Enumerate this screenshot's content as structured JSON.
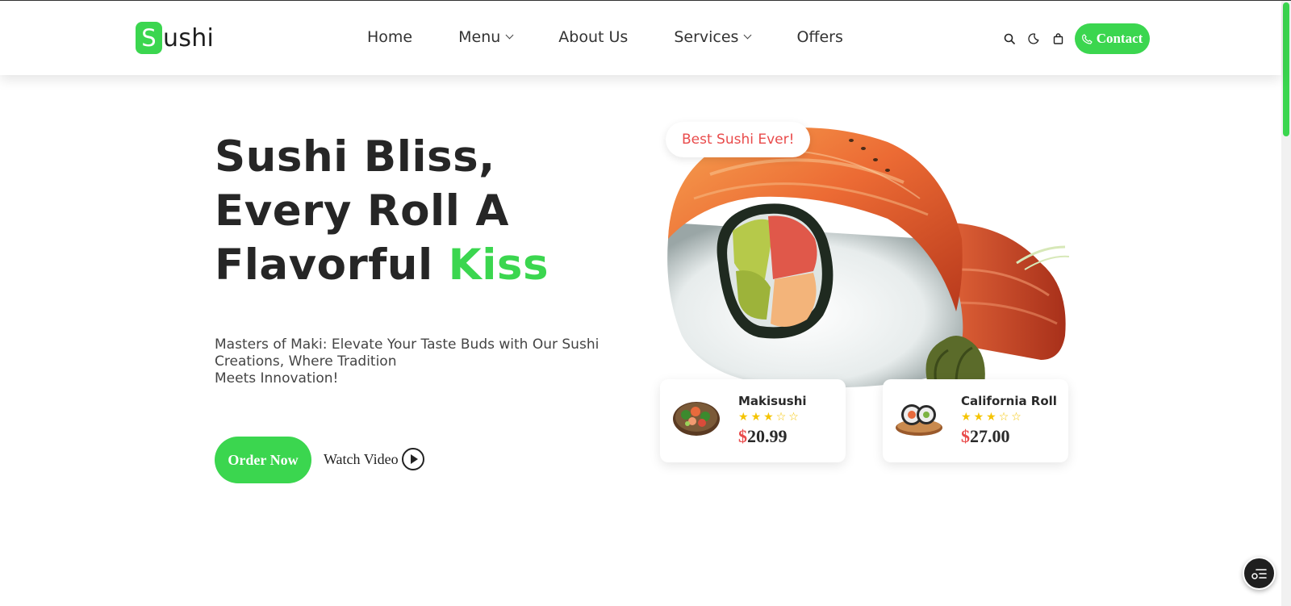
{
  "header": {
    "logo_letter": "S",
    "logo_rest": "ushi",
    "nav": [
      {
        "label": "Home",
        "has_dropdown": false
      },
      {
        "label": "Menu",
        "has_dropdown": true
      },
      {
        "label": "About Us",
        "has_dropdown": false
      },
      {
        "label": "Services",
        "has_dropdown": true
      },
      {
        "label": "Offers",
        "has_dropdown": false
      }
    ],
    "tools": [
      "search-icon",
      "moon-icon",
      "shopping-bag-icon"
    ],
    "contact_label": "Contact"
  },
  "hero": {
    "title_line1": "Sushi Bliss,",
    "title_line2": "Every Roll A",
    "title_line3_plain": "Flavorful ",
    "title_line3_accent": "Kiss",
    "subtitle_line1": "Masters of Maki: Elevate Your Taste Buds with Our Sushi",
    "subtitle_line2": "Creations, Where Tradition",
    "subtitle_line3": "Meets Innovation!",
    "order_label": "Order Now",
    "watch_label": "Watch Video",
    "badge": "Best Sushi Ever!"
  },
  "cards": [
    {
      "name": "Makisushi",
      "rating": 3,
      "max_rating": 5,
      "currency": "$",
      "price": "20.99"
    },
    {
      "name": "California Roll",
      "rating": 3,
      "max_rating": 5,
      "currency": "$",
      "price": "27.00"
    }
  ],
  "colors": {
    "accent": "#3bd64f",
    "price_currency": "#e94b4b",
    "badge_text": "#e94b4b",
    "star": "#f5c400",
    "heading": "#262626"
  }
}
